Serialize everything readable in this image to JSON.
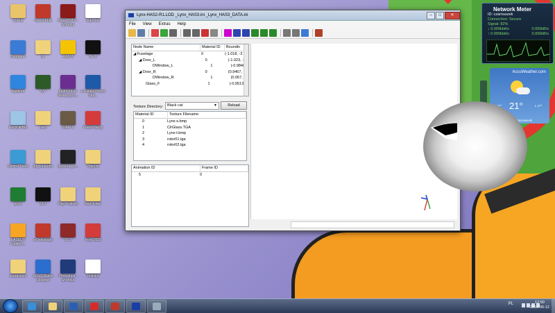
{
  "desktop": {
    "icons": [
      {
        "label": "czarny",
        "color": "#e9c46a"
      },
      {
        "label": "Opera Mail",
        "color": "#c0392b"
      },
      {
        "label": "BlazeHDTV - Shortcut",
        "color": "#8b1a1a"
      },
      {
        "label": "logo.mel",
        "color": "#ffffff"
      },
      {
        "label": "Computer",
        "color": "#3a7bd5"
      },
      {
        "label": "lib",
        "color": "#f0d27a"
      },
      {
        "label": "AIMP3",
        "color": "#f5c400"
      },
      {
        "label": "SF 2",
        "color": "#111111"
      },
      {
        "label": "Network",
        "color": "#2e86de"
      },
      {
        "label": "WP",
        "color": "#2d5a27"
      },
      {
        "label": "Matmodeler Weekly-pro...",
        "color": "#6b2d8f"
      },
      {
        "label": "e-Katalog Micro Sea...",
        "color": "#1e5aa8"
      },
      {
        "label": "Recycle Bin",
        "color": "#9cc5e6"
      },
      {
        "label": "nero",
        "color": "#f0d27a"
      },
      {
        "label": "GIMP 2",
        "color": "#6b5a44"
      },
      {
        "label": "Prawo Jazdy",
        "color": "#d43b3b"
      },
      {
        "label": "Control Panel",
        "color": "#3a9bd5"
      },
      {
        "label": "3d_converter",
        "color": "#f0d27a"
      },
      {
        "label": "dcphone_w...",
        "color": "#222222"
      },
      {
        "label": "Objects",
        "color": "#f0d27a"
      },
      {
        "label": "proto",
        "color": "#1e7d32"
      },
      {
        "label": "SF2",
        "color": "#111111"
      },
      {
        "label": "Play Fraktory",
        "color": "#f0d27a"
      },
      {
        "label": "New folder",
        "color": "#f0d27a"
      },
      {
        "label": "EASEUS Partition...",
        "color": "#f6a623"
      },
      {
        "label": "e-Deklaracje",
        "color": "#c0392b"
      },
      {
        "label": "SF 2",
        "color": "#8e2a2a"
      },
      {
        "label": "Testy 2015",
        "color": "#d43b3b"
      },
      {
        "label": "urządzenie",
        "color": "#f0d27a"
      },
      {
        "label": "LEGO Digital Designer",
        "color": "#2a6fcf"
      },
      {
        "label": "Photoshop - Shortcut",
        "color": "#1f3b7a"
      },
      {
        "label": "Untitled",
        "color": "#ffffff"
      }
    ]
  },
  "window": {
    "title": "Lynx-HAS2-R1.LOD _Lynx_HAS3.ini _Lynx_HAS3_DATA.ini",
    "controls": {
      "minimize": "–",
      "maximize": "□",
      "close": "✕"
    },
    "menu": [
      "File",
      "View",
      "Extras",
      "Help"
    ],
    "toolbar_colors": [
      "#e8b84a",
      "#5f7da8",
      "#d44",
      "#3aa53a",
      "#666",
      "#666",
      "#666",
      "#c33",
      "#888",
      "#c0c",
      "#3044b0",
      "#3044b0",
      "#2a8a2a",
      "#2a8a2a",
      "#2a8a2a",
      "#777",
      "#777",
      "#3b7bd6",
      "#b0402a"
    ],
    "node_tree": {
      "headers": [
        "Node Name",
        "Material ID",
        "Boundin"
      ],
      "rows": [
        {
          "name": "◢ Fuselage",
          "mat": "0",
          "bound": "(-1.018, -3"
        },
        {
          "name": "◢ Door_L",
          "mat": "0",
          "bound": "(-1.023, -0"
        },
        {
          "name": "DWindow_L",
          "mat": "1",
          "bound": "(-0.9848, 0"
        },
        {
          "name": "◢ Door_R",
          "mat": "0",
          "bound": "(0.9467, -0"
        },
        {
          "name": "DWindow_R",
          "mat": "1",
          "bound": "(0.067, 0.2"
        },
        {
          "name": "Glass_F",
          "mat": "1",
          "bound": "(-0.9513, 2"
        }
      ]
    },
    "texture": {
      "label": "Texture Directory:",
      "selected": "Black cat",
      "reload": "Reload",
      "headers": [
        "Material ID",
        "Texture Filename"
      ],
      "rows": [
        {
          "id": "0",
          "file": "Lynx-s.bmp"
        },
        {
          "id": "1",
          "file": "ClrGlass.TGA"
        },
        {
          "id": "2",
          "file": "Lynx-t.bmp"
        },
        {
          "id": "3",
          "file": "rotor01.tga"
        },
        {
          "id": "4",
          "file": "rotor02.tga"
        }
      ]
    },
    "animation": {
      "headers": [
        "Animation ID",
        "Frame ID"
      ],
      "rows": [
        {
          "id": "5",
          "frame": "0"
        }
      ]
    },
    "viewport": {
      "axis_colors": {
        "x": "#e53935",
        "y": "#43a047",
        "z": "#1e3cc8"
      }
    }
  },
  "gadgets": {
    "network": {
      "title": "Network Meter",
      "lines": [
        "ID: czarnuszek",
        "Connection: Secure",
        "Signal: 82%"
      ],
      "down_label": "0.000kbit/s",
      "down_value": "0.000kB/s",
      "up_label": "0.000kbit/s",
      "up_value": "0.000kB/s"
    },
    "weather": {
      "brand": "AccuWeather.com",
      "temp": "21°",
      "hi": "H 27°",
      "lo": "L 17°",
      "city": "Mińsk Mazowiecki"
    }
  },
  "taskbar": {
    "apps": [
      {
        "name": "ie",
        "color": "#3a8fd8"
      },
      {
        "name": "explorer",
        "color": "#f0d27a"
      },
      {
        "name": "word",
        "color": "#2b5fb4"
      },
      {
        "name": "opera",
        "color": "#d62b2b"
      },
      {
        "name": "opera-mail",
        "color": "#c0392b"
      },
      {
        "name": "lod-viewer",
        "color": "#1a3ea6"
      },
      {
        "name": "tool",
        "color": "#9ab"
      }
    ],
    "lang": "PL",
    "time": "12:50",
    "date": "2015-06-12"
  }
}
